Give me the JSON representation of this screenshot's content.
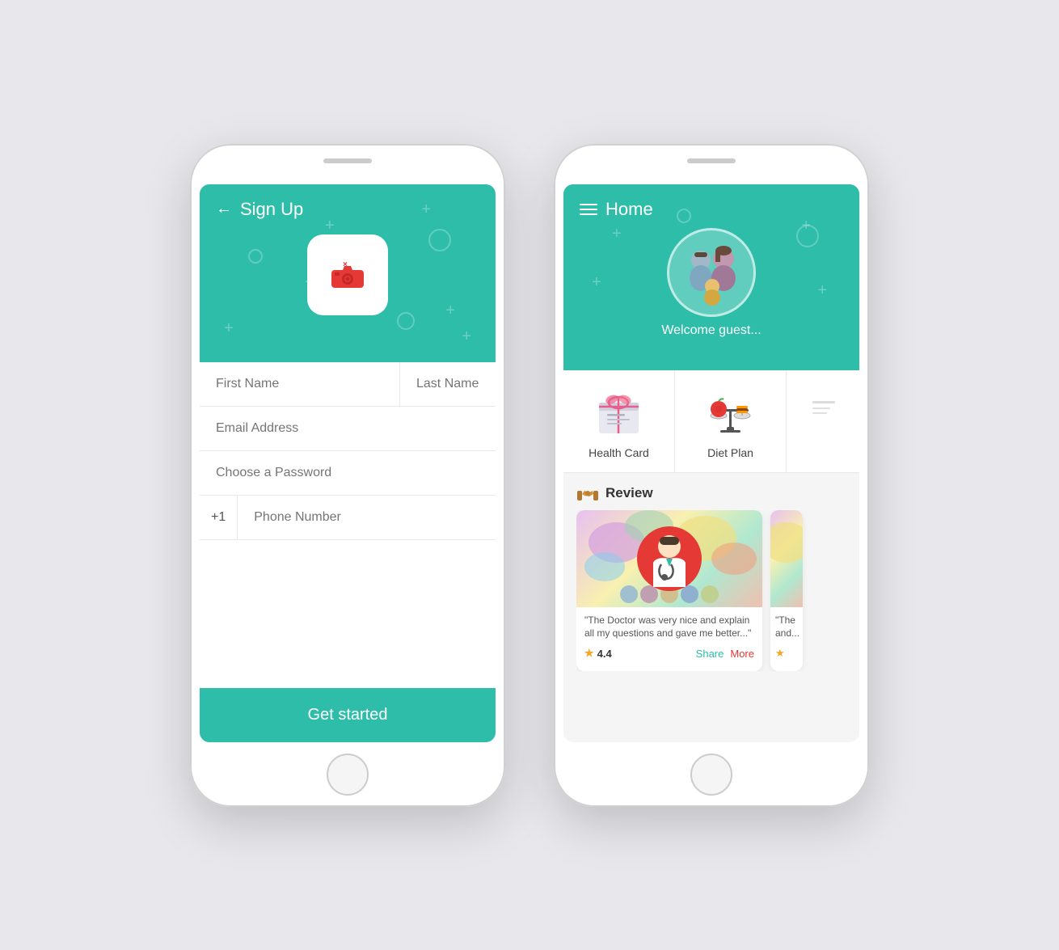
{
  "phone1": {
    "header": {
      "back_label": "←",
      "title": "Sign Up"
    },
    "form": {
      "first_name_placeholder": "First Name",
      "last_name_placeholder": "Last Name",
      "email_placeholder": "Email Address",
      "password_placeholder": "Choose a Password",
      "phone_prefix": "+1",
      "phone_placeholder": "Phone Number"
    },
    "cta": "Get started"
  },
  "phone2": {
    "header": {
      "title": "Home",
      "welcome": "Welcome guest..."
    },
    "cards": [
      {
        "label": "Health Card"
      },
      {
        "label": "Diet Plan"
      },
      {
        "label": "..."
      }
    ],
    "review": {
      "section_title": "Review",
      "items": [
        {
          "text": "\"The Doctor was very nice and explain all my questions and gave me better...\"",
          "rating": "4.4",
          "share_label": "Share",
          "more_label": "More"
        },
        {
          "text": "\"The and...",
          "rating": ""
        }
      ]
    }
  }
}
